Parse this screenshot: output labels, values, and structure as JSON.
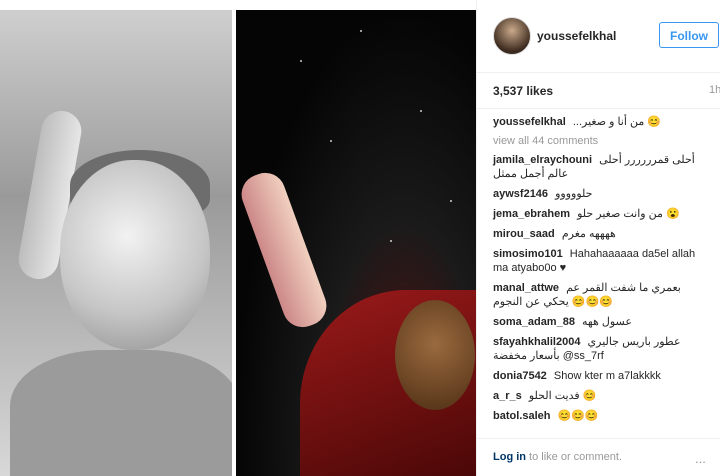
{
  "post": {
    "username": "youssefelkhal",
    "follow_label": "Follow",
    "likes": "3,537 likes",
    "time": "1h"
  },
  "comments": {
    "view_all": "view all 44 comments",
    "items": [
      {
        "user": "youssefelkhal",
        "text": "...من أنا و صغير 😊"
      },
      {
        "user": "jamila_elraychouni",
        "text": "أحلى قمرررررر أحلى عالم أجمل ممثل"
      },
      {
        "user": "aywsf2146",
        "text": "حلووووو"
      },
      {
        "user": "jema_ebrahem",
        "text": "من وانت صغير حلو 😮"
      },
      {
        "user": "mirou_saad",
        "text": "ههههه مغرم"
      },
      {
        "user": "simosimo101",
        "text": "Hahahaaaaaa da5el allah ma atyabo0o ♥"
      },
      {
        "user": "manal_attwe",
        "text": "بعمري ما شفت القمر عم يحكي عن النجوم 😊😊😊"
      },
      {
        "user": "soma_adam_88",
        "text": "عسول ههه"
      },
      {
        "user": "sfayahkhalil2004",
        "text": "عطور باريس جاليري بأسعار مخفضة @ss_7rf"
      },
      {
        "user": "donia7542",
        "text": "Show kter m a7lakkkk"
      },
      {
        "user": "a_r_s",
        "text": "فديت الحلو 😊"
      },
      {
        "user": "batol.saleh",
        "text": "😊😊😊"
      }
    ]
  },
  "footer": {
    "login_link": "Log in",
    "login_rest": " to like or comment.",
    "more": "..."
  },
  "icons": {
    "more": "more-options-icon"
  }
}
